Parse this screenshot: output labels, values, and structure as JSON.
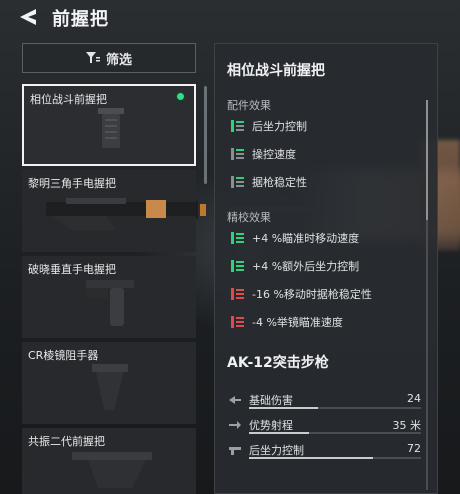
{
  "header": {
    "title": "前握把"
  },
  "filter": {
    "label": "筛选"
  },
  "items": [
    {
      "label": "相位战斗前握把",
      "selected": true,
      "equipped": true
    },
    {
      "label": "黎明三角手电握把",
      "selected": false
    },
    {
      "label": "破晓垂直手电握把",
      "selected": false
    },
    {
      "label": "CR棱镜阻手器",
      "selected": false
    },
    {
      "label": "共振二代前握把",
      "selected": false
    }
  ],
  "panel": {
    "title": "相位战斗前握把",
    "attachment_effects_label": "配件效果",
    "attachment_effects": [
      {
        "text": "后坐力控制",
        "icon": "stat-green-icon"
      },
      {
        "text": "操控速度",
        "icon": "stat-gray-icon"
      },
      {
        "text": "据枪稳定性",
        "icon": "stat-gray-icon"
      }
    ],
    "refine_effects_label": "精校效果",
    "refine_effects": [
      {
        "text": "+4 %瞄准时移动速度",
        "polarity": "positive",
        "icon": "stat-up-icon"
      },
      {
        "text": "+4 %额外后坐力控制",
        "polarity": "positive",
        "icon": "stat-up-icon"
      },
      {
        "text": "-16 %移动时据枪稳定性",
        "polarity": "negative",
        "icon": "stat-down-icon"
      },
      {
        "text": "-4 %举镜瞄准速度",
        "polarity": "negative",
        "icon": "stat-down-icon"
      }
    ],
    "weapon_name": "AK-12突击步枪",
    "stats": [
      {
        "name": "基础伤害",
        "value": "24",
        "fill": 0.4,
        "icon": "damage-icon"
      },
      {
        "name": "优势射程",
        "value": "35 米",
        "fill": 0.35,
        "icon": "range-icon"
      },
      {
        "name": "后坐力控制",
        "value": "72",
        "fill": 0.72,
        "icon": "recoil-icon"
      }
    ]
  },
  "colors": {
    "positive": "#2fd17a",
    "negative": "#e04a4a",
    "neutral": "#8a8f93",
    "equipped_dot": "#39d98a"
  }
}
